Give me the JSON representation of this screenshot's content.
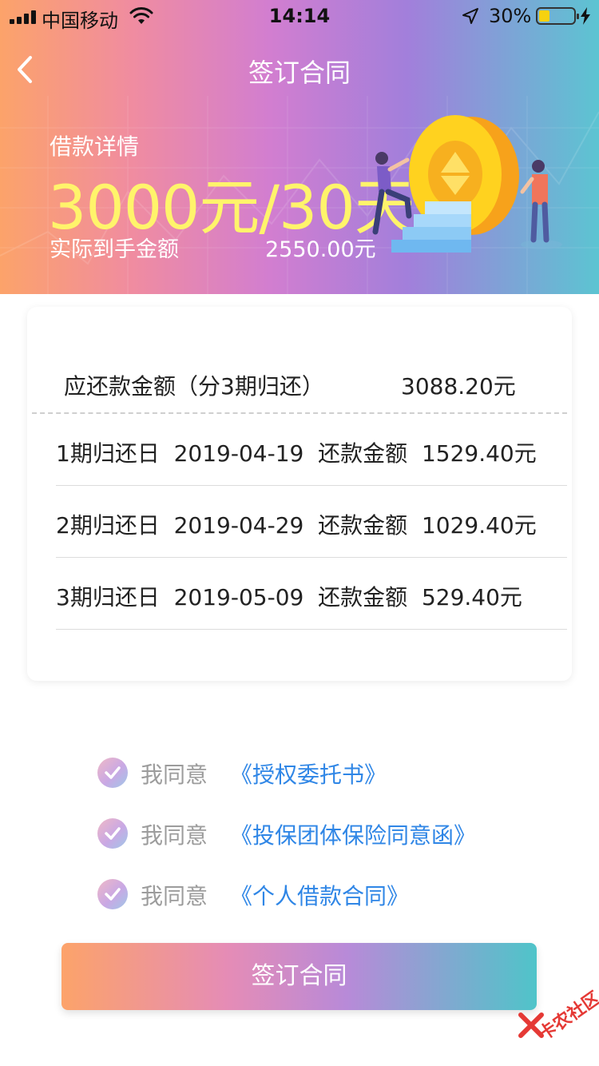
{
  "status_bar": {
    "carrier": "中国移动",
    "time": "14:14",
    "battery_percent": "30%",
    "battery_level": 0.3
  },
  "nav": {
    "back_icon": "chevron-left-icon",
    "title": "签订合同"
  },
  "loan": {
    "label": "借款详情",
    "amount": "3000元/30天",
    "actual_label": "实际到手金额",
    "actual_value": "2550.00元"
  },
  "repayment": {
    "total_label": "应还款金额（分3期归还）",
    "total_value": "3088.20元",
    "periods": [
      {
        "text": "1期归还日  2019-04-19  还款金额  1529.40元"
      },
      {
        "text": "2期归还日  2019-04-29  还款金额  1029.40元"
      },
      {
        "text": "3期归还日  2019-05-09  还款金额  529.40元"
      }
    ]
  },
  "agreements": [
    {
      "prefix": "我同意",
      "link": "《授权委托书》",
      "checked": true
    },
    {
      "prefix": "我同意",
      "link": "《投保团体保险同意函》",
      "checked": true
    },
    {
      "prefix": "我同意",
      "link": "《个人借款合同》",
      "checked": true
    }
  ],
  "sign_button": "签订合同",
  "watermark": "卡农社区",
  "colors": {
    "link": "#2f86e6",
    "amount_highlight": "#fff46b",
    "gradient_start": "#fca36a",
    "gradient_mid": "#d27ed0",
    "gradient_end": "#5cc4d2"
  }
}
